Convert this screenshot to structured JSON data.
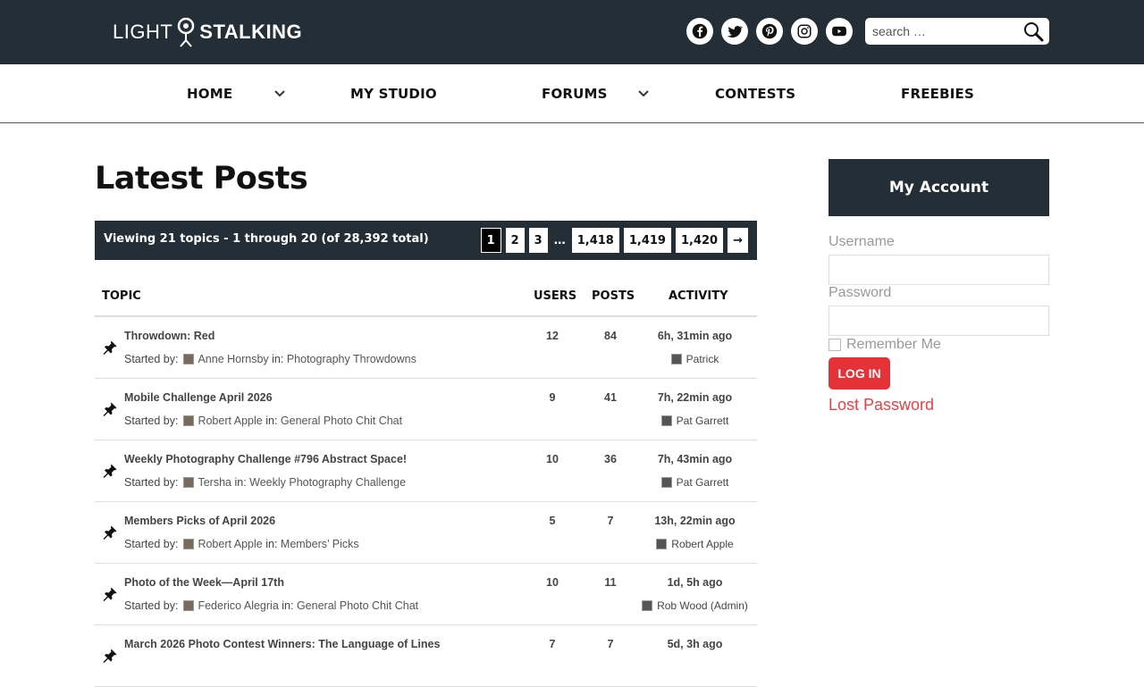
{
  "header": {
    "logo_light": "LIGHT",
    "logo_stalking": "STALKING",
    "social_icons": [
      "facebook-icon",
      "twitter-icon",
      "pinterest-icon",
      "instagram-icon",
      "youtube-icon"
    ],
    "search_placeholder": "search …",
    "bg_color": "#232e36"
  },
  "nav": {
    "items": [
      {
        "label": "HOME",
        "has_dropdown": true
      },
      {
        "label": "MY STUDIO",
        "has_dropdown": false
      },
      {
        "label": "FORUMS",
        "has_dropdown": true
      },
      {
        "label": "CONTESTS",
        "has_dropdown": false
      },
      {
        "label": "FREEBIES",
        "has_dropdown": false
      }
    ]
  },
  "main": {
    "title": "Latest Posts",
    "viewing_text": "Viewing 21 topics - 1 through 20 (of 28,392 total)",
    "pagination": [
      "1",
      "2",
      "3",
      "…",
      "1,418",
      "1,419",
      "1,420",
      "→"
    ],
    "columns": [
      "TOPIC",
      "USERS",
      "POSTS",
      "ACTIVITY"
    ],
    "started_by_label": "Started by:",
    "in_label": "in:",
    "topics": [
      {
        "title": "Throwdown: Red",
        "author": "Anne Hornsby",
        "forum": "Photography Throwdowns",
        "users": "12",
        "posts": "84",
        "activity": "6h, 31min ago",
        "last_by": "Patrick"
      },
      {
        "title": "Mobile Challenge April 2026",
        "author": "Robert Apple",
        "forum": "General Photo Chit Chat",
        "users": "9",
        "posts": "41",
        "activity": "7h, 22min ago",
        "last_by": "Pat Garrett"
      },
      {
        "title": "Weekly Photography Challenge #796 Abstract Space!",
        "author": "Tersha",
        "forum": "Weekly Photography Challenge",
        "users": "10",
        "posts": "36",
        "activity": "7h, 43min ago",
        "last_by": "Pat Garrett"
      },
      {
        "title": "Members Picks of April 2026",
        "author": "Robert Apple",
        "forum": "Members’ Picks",
        "users": "5",
        "posts": "7",
        "activity": "13h, 22min ago",
        "last_by": "Robert Apple"
      },
      {
        "title": "Photo of the Week—April 17th",
        "author": "Federico Alegria",
        "forum": "General Photo Chit Chat",
        "users": "10",
        "posts": "11",
        "activity": "1d, 5h ago",
        "last_by": "Rob Wood (Admin)"
      },
      {
        "title": "March 2026 Photo Contest Winners: The Language of Lines",
        "author": "",
        "forum": "",
        "users": "7",
        "posts": "7",
        "activity": "5d, 3h ago",
        "last_by": ""
      }
    ]
  },
  "sidebar": {
    "account_title": "My Account",
    "username_label": "Username",
    "password_label": "Password",
    "remember_label": "Remember Me",
    "login_label": "LOG IN",
    "lost_password": "Lost Password",
    "accent_color": "#e53238"
  }
}
